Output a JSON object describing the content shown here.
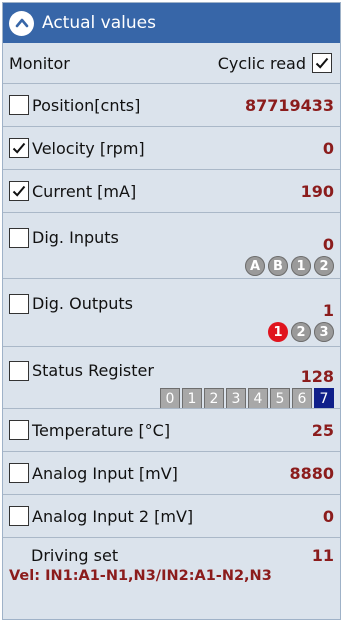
{
  "header": {
    "title": "Actual values",
    "collapse_icon": "chevron-up-icon"
  },
  "monitor": {
    "label": "Monitor",
    "cyclic_label": "Cyclic read",
    "cyclic_checked": true
  },
  "items": {
    "position": {
      "label": "Position[cnts]",
      "value": "87719433",
      "checked": false
    },
    "velocity": {
      "label": "Velocity [rpm]",
      "value": "0",
      "checked": true
    },
    "current": {
      "label": "Current [mA]",
      "value": "190",
      "checked": true
    },
    "dig_inputs": {
      "label": "Dig. Inputs",
      "value": "0",
      "bubbles": [
        "A",
        "B",
        "1",
        "2"
      ]
    },
    "dig_outputs": {
      "label": "Dig. Outputs",
      "value": "1",
      "bubbles": [
        "1",
        "2",
        "3"
      ],
      "active_index": 0
    },
    "status_register": {
      "label": "Status Register",
      "value": "128",
      "bits": [
        "0",
        "1",
        "2",
        "3",
        "4",
        "5",
        "6",
        "7"
      ],
      "active_index": 7
    },
    "temperature": {
      "label": "Temperature [°C]",
      "value": "25"
    },
    "analog1": {
      "label": "Analog Input [mV]",
      "value": "8880"
    },
    "analog2": {
      "label": "Analog Input 2 [mV]",
      "value": "0"
    }
  },
  "driving_set": {
    "label": "Driving set",
    "value": "11",
    "vel_text": "Vel: IN1:A1-N1,N3/IN2:A1-N2,N3"
  },
  "colors": {
    "header_bg": "#3766a8",
    "panel_bg": "#dbe3ec",
    "value_text": "#8b1c1c",
    "active_output": "#e0141e",
    "active_bit": "#0f1f8a"
  }
}
